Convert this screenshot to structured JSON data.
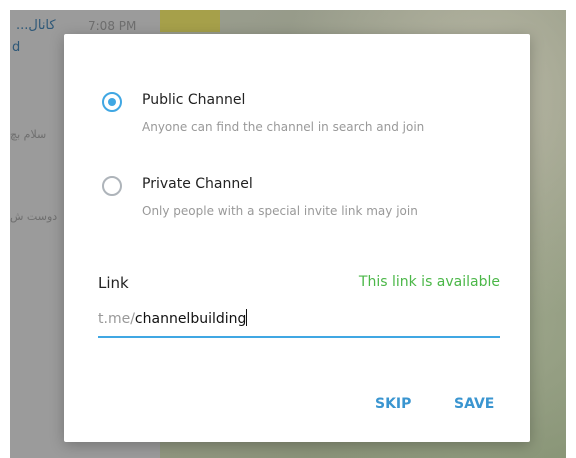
{
  "background": {
    "chat_title": "...کانال",
    "time": "7:08 PM",
    "subtitle": "d",
    "snippet_1": "سلام بچ",
    "snippet_2": "دوست ش"
  },
  "dialog": {
    "options": [
      {
        "title": "Public Channel",
        "description": "Anyone can find the channel in search and join",
        "selected": true
      },
      {
        "title": "Private Channel",
        "description": "Only people with a special invite link may join",
        "selected": false
      }
    ],
    "link_label": "Link",
    "link_status": "This link is available",
    "link_prefix": "t.me/",
    "link_value": "channelbuilding",
    "buttons": {
      "skip": "SKIP",
      "save": "SAVE"
    }
  },
  "colors": {
    "accent": "#40a7e3",
    "button_text": "#3a95d0",
    "available": "#4bb748"
  }
}
